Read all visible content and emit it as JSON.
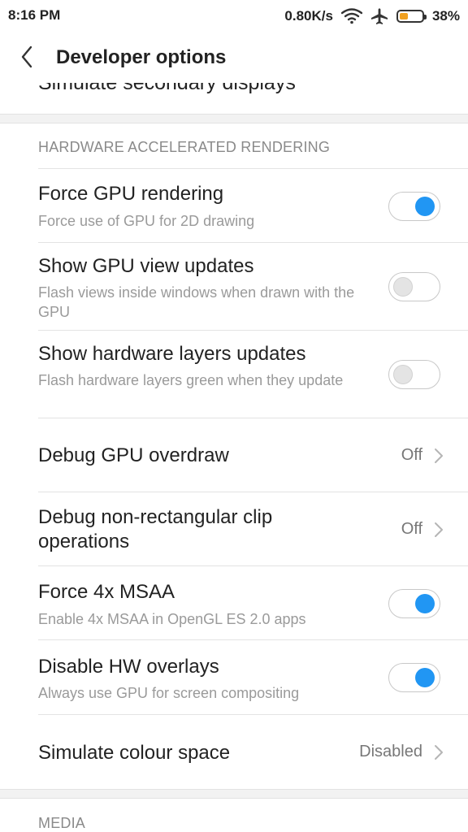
{
  "status_bar": {
    "time": "8:16 PM",
    "speed": "0.80K/s",
    "battery": "38%",
    "icons": [
      "wifi-icon",
      "airplane-icon",
      "battery-icon"
    ],
    "battery_level": 0.38
  },
  "app_bar": {
    "title": "Developer options",
    "back_icon": "chevron-left-icon"
  },
  "partial_item": {
    "title": "Simulate secondary displays"
  },
  "sections": {
    "hardware": {
      "header": "HARDWARE ACCELERATED RENDERING"
    },
    "media": {
      "header": "MEDIA"
    }
  },
  "items": [
    {
      "title": "Force GPU rendering",
      "subtitle": "Force use of GPU for 2D drawing",
      "control": "toggle",
      "checked": true
    },
    {
      "title": "Show GPU view updates",
      "subtitle": "Flash views inside windows when drawn with the GPU",
      "control": "toggle",
      "checked": false
    },
    {
      "title": "Show hardware layers updates",
      "subtitle": "Flash hardware layers green when they update",
      "control": "toggle",
      "checked": false
    },
    {
      "title": "Debug GPU overdraw",
      "value": "Off",
      "control": "chevron"
    },
    {
      "title": "Debug non-rectangular clip operations",
      "value": "Off",
      "control": "chevron"
    },
    {
      "title": "Force 4x MSAA",
      "subtitle": "Enable 4x MSAA in OpenGL ES 2.0 apps",
      "control": "toggle",
      "checked": true
    },
    {
      "title": "Disable HW overlays",
      "subtitle": "Always use GPU for screen compositing",
      "control": "toggle",
      "checked": true
    },
    {
      "title": "Simulate colour space",
      "value": "Disabled",
      "control": "chevron"
    }
  ],
  "colors": {
    "accent": "#2196f3",
    "battery": "#f0a020"
  }
}
